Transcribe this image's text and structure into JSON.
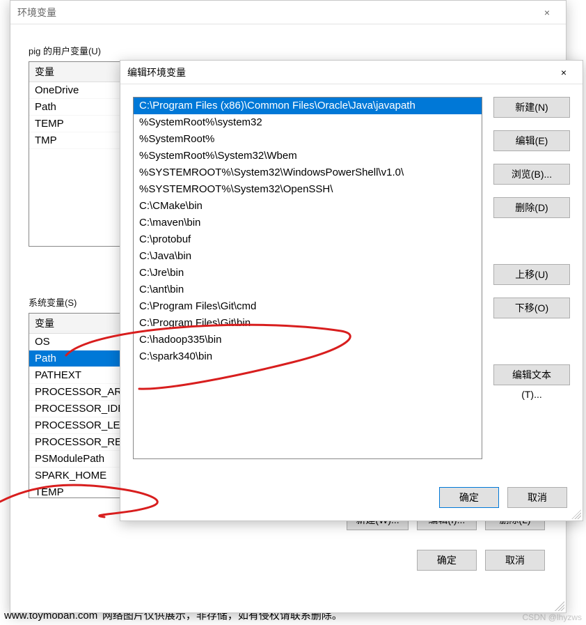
{
  "outer": {
    "title": "环境变量",
    "close": "×",
    "user_section_label": "pig 的用户变量(U)",
    "user_header": "变量",
    "user_vars": [
      "OneDrive",
      "Path",
      "TEMP",
      "TMP"
    ],
    "sys_section_label": "系统变量(S)",
    "sys_header": "变量",
    "sys_vars": [
      "OS",
      "Path",
      "PATHEXT",
      "PROCESSOR_AR",
      "PROCESSOR_IDE",
      "PROCESSOR_LE",
      "PROCESSOR_RE",
      "PSModulePath",
      "SPARK_HOME",
      "TEMP"
    ],
    "sys_selected_index": 1,
    "buttons": {
      "new": "新建(W)...",
      "edit": "编辑(I)...",
      "delete": "删除(L)",
      "ok": "确定",
      "cancel": "取消"
    }
  },
  "edit": {
    "title": "编辑环境变量",
    "close": "×",
    "selected_index": 0,
    "paths": [
      "C:\\Program Files (x86)\\Common Files\\Oracle\\Java\\javapath",
      "%SystemRoot%\\system32",
      "%SystemRoot%",
      "%SystemRoot%\\System32\\Wbem",
      "%SYSTEMROOT%\\System32\\WindowsPowerShell\\v1.0\\",
      "%SYSTEMROOT%\\System32\\OpenSSH\\",
      "C:\\CMake\\bin",
      "C:\\maven\\bin",
      "C:\\protobuf",
      "C:\\Java\\bin",
      "C:\\Jre\\bin",
      "C:\\ant\\bin",
      "C:\\Program Files\\Git\\cmd",
      "C:\\Program Files\\Git\\bin",
      "C:\\hadoop335\\bin",
      "C:\\spark340\\bin"
    ],
    "buttons": {
      "new": "新建(N)",
      "edit": "编辑(E)",
      "browse": "浏览(B)...",
      "delete": "删除(D)",
      "moveup": "上移(U)",
      "movedown": "下移(O)",
      "edittext": "编辑文本(T)...",
      "ok": "确定",
      "cancel": "取消"
    }
  },
  "footer": {
    "site": "www.toymoban.com",
    "note": "网络图片仅供展示，非存储，如有侵权请联系删除。",
    "csdn": "CSDN @lhyzws"
  }
}
